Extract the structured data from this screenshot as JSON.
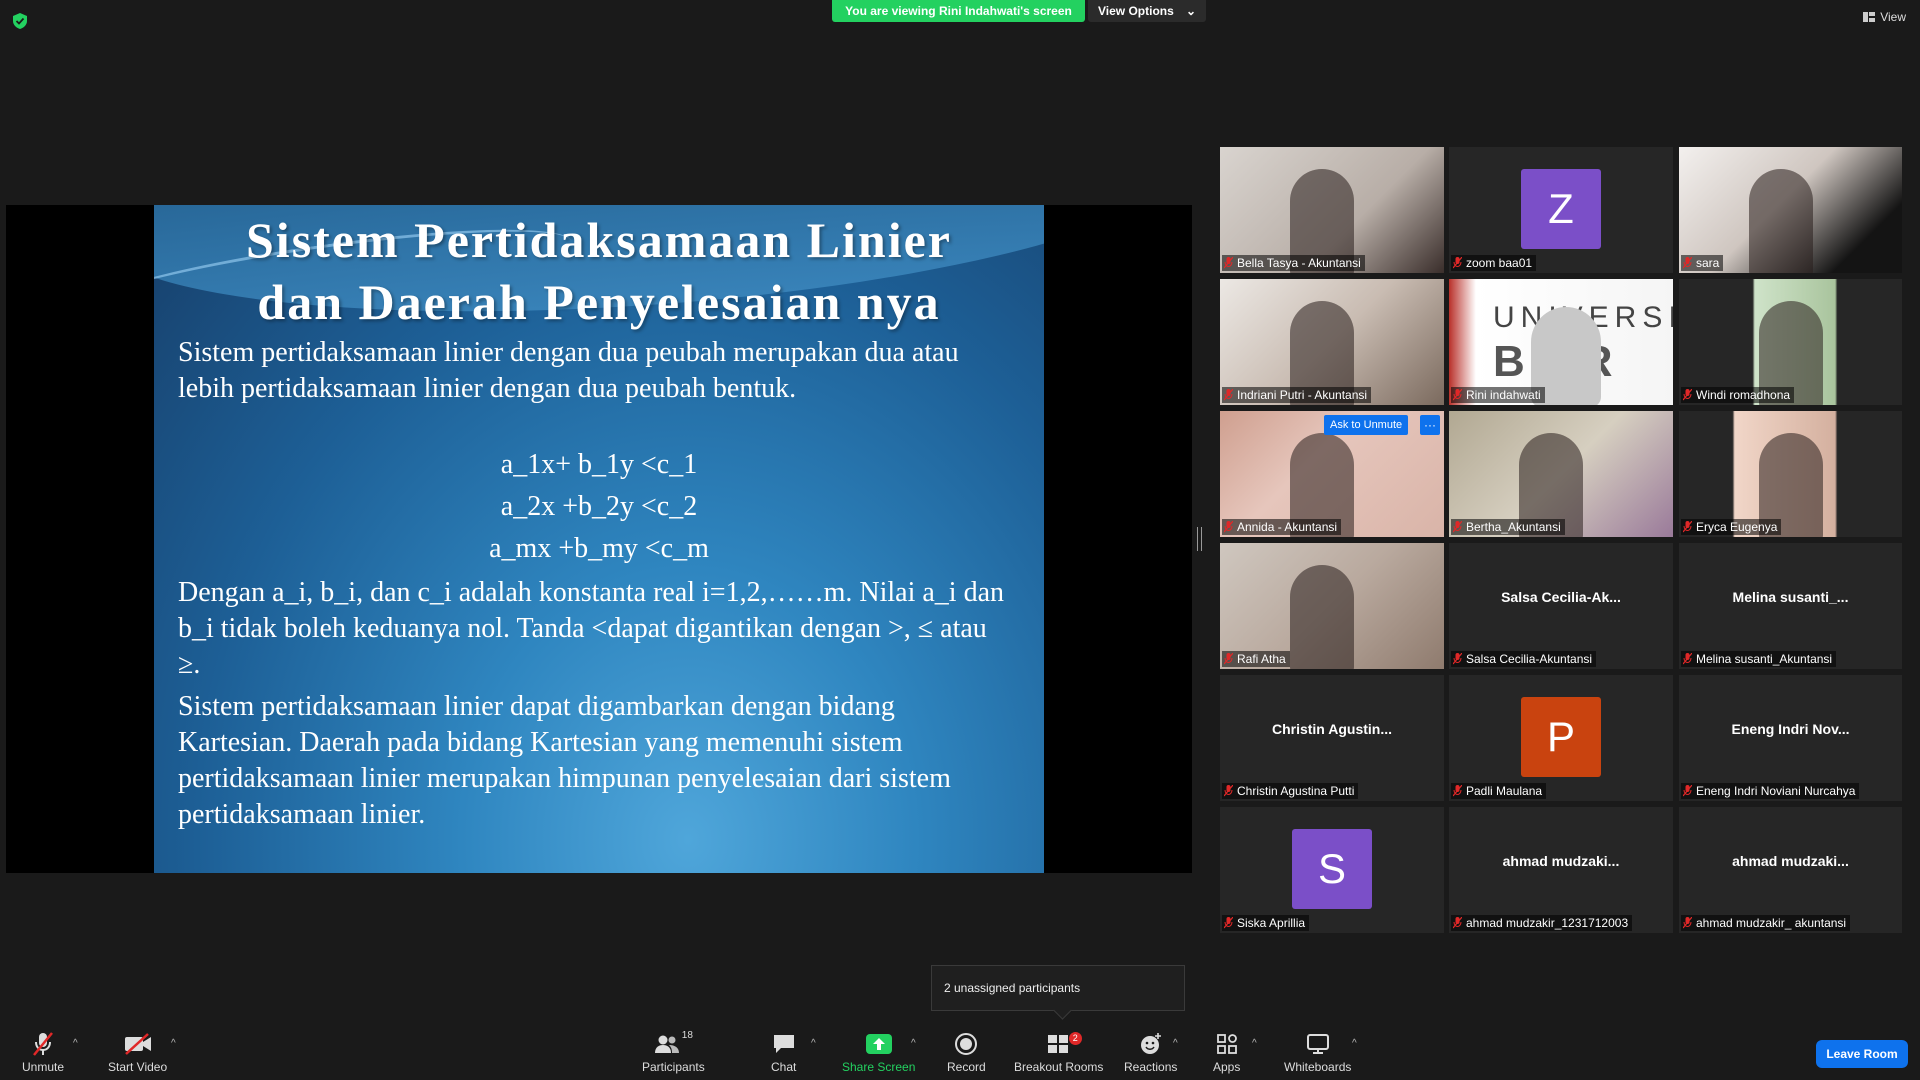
{
  "top": {
    "banner": "You are viewing Rini Indahwati's screen",
    "view_options": "View Options",
    "view": "View"
  },
  "slide": {
    "title_line1": "Sistem Pertidaksamaan Linier",
    "title_line2": "dan Daerah Penyelesaian nya",
    "para1": "Sistem pertidaksamaan linier dengan dua peubah merupakan dua atau lebih pertidaksamaan linier dengan dua peubah bentuk.",
    "eq1": "a_1x+ b_1y <c_1",
    "eq2": "a_2x +b_2y <c_2",
    "eq3": "a_mx +b_my <c_m",
    "para2": "Dengan a_i, b_i, dan c_i adalah konstanta real i=1,2,……m. Nilai a_i dan b_i tidak boleh keduanya nol. Tanda <dapat digantikan dengan >,  ≤ atau ≥.",
    "para3": "Sistem pertidaksamaan linier dapat digambarkan dengan bidang Kartesian. Daerah pada bidang Kartesian yang memenuhi sistem pertidaksamaan linier merupakan himpunan penyelesaian dari sistem pertidaksamaan linier."
  },
  "gallery": [
    {
      "name": "Bella Tasya - Akuntansi",
      "type": "video"
    },
    {
      "name": "zoom baa01",
      "type": "avatar",
      "letter": "Z",
      "color": "#7b4fc8"
    },
    {
      "name": "sara",
      "type": "video"
    },
    {
      "name": "Indriani Putri - Akuntansi",
      "type": "video"
    },
    {
      "name": "Rini indahwati",
      "type": "video",
      "sign_text": "UNIVERSI",
      "sign_text2": "B  KR"
    },
    {
      "name": "Windi romadhona",
      "type": "video"
    },
    {
      "name": "Annida - Akuntansi",
      "type": "video"
    },
    {
      "name": "Bertha_Akuntansi",
      "type": "video"
    },
    {
      "name": "Eryca Eugenya",
      "type": "video"
    },
    {
      "name": "Rafi Atha",
      "type": "video"
    },
    {
      "name": "Salsa Cecilia-Akuntansi",
      "type": "text",
      "display": "Salsa  Cecilia-Ak..."
    },
    {
      "name": "Melina susanti_Akuntansi",
      "type": "text",
      "display": "Melina  susanti_..."
    },
    {
      "name": "Christin Agustina Putti",
      "type": "text",
      "display": "Christin  Agustin..."
    },
    {
      "name": "Padli Maulana",
      "type": "avatar",
      "letter": "P",
      "color": "#c9430f"
    },
    {
      "name": "Eneng Indri Noviani Nurcahya",
      "type": "text",
      "display": "Eneng  Indri  Nov..."
    },
    {
      "name": "Siska Aprillia",
      "type": "avatar",
      "letter": "S",
      "color": "#7b4fc8"
    },
    {
      "name": "ahmad mudzakir_1231712003",
      "type": "text",
      "display": "ahmad  mudzaki..."
    },
    {
      "name": "ahmad mudzakir_ akuntansi",
      "type": "text",
      "display": "ahmad  mudzaki..."
    }
  ],
  "ask_unmute": "Ask to Unmute",
  "more": "···",
  "tooltip": "2 unassigned participants",
  "toolbar": {
    "unmute": "Unmute",
    "start_video": "Start Video",
    "participants": "Participants",
    "participants_count": "18",
    "chat": "Chat",
    "share_screen": "Share Screen",
    "record": "Record",
    "breakout_rooms": "Breakout Rooms",
    "breakout_badge": "2",
    "reactions": "Reactions",
    "apps": "Apps",
    "whiteboards": "Whiteboards",
    "leave_room": "Leave Room",
    "caret": "^"
  },
  "colors": {
    "accent_blue": "#0e72ed",
    "banner_green": "#23d160",
    "share_green": "#23d160",
    "active_speaker": "#e6e65a"
  }
}
